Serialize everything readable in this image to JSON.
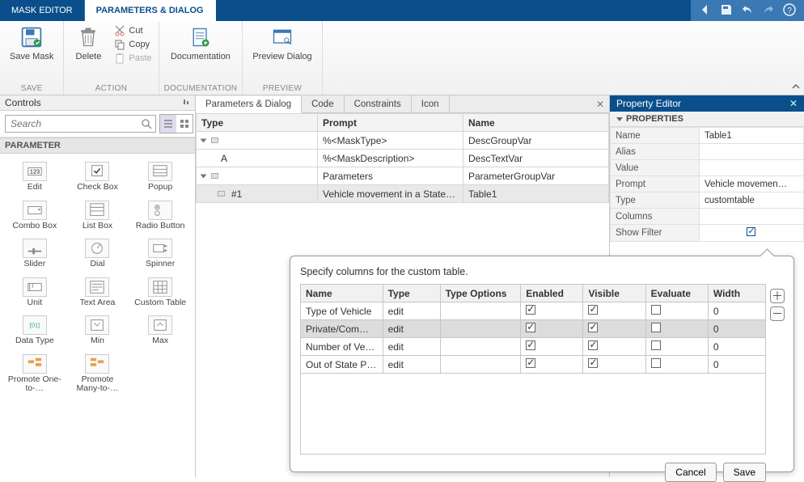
{
  "top_tabs": {
    "mask_editor": "MASK EDITOR",
    "parameters_dialog": "PARAMETERS & DIALOG"
  },
  "ribbon": {
    "save": {
      "save_mask": "Save Mask",
      "group": "SAVE"
    },
    "action": {
      "delete": "Delete",
      "cut": "Cut",
      "copy": "Copy",
      "paste": "Paste",
      "group": "ACTION"
    },
    "documentation": {
      "btn": "Documentation",
      "group": "DOCUMENTATION"
    },
    "preview": {
      "btn": "Preview Dialog",
      "group": "PREVIEW"
    }
  },
  "controls": {
    "title": "Controls",
    "search_placeholder": "Search",
    "section": "PARAMETER",
    "items": [
      "Edit",
      "Check Box",
      "Popup",
      "Combo Box",
      "List Box",
      "Radio Button",
      "Slider",
      "Dial",
      "Spinner",
      "Unit",
      "Text Area",
      "Custom Table",
      "Data Type",
      "Min",
      "Max",
      "Promote One-to-…",
      "Promote Many-to-…"
    ]
  },
  "center_tabs": {
    "params": "Parameters & Dialog",
    "code": "Code",
    "constraints": "Constraints",
    "icon": "Icon"
  },
  "params_header": {
    "type": "Type",
    "prompt": "Prompt",
    "name": "Name"
  },
  "params_rows": [
    {
      "indent": 0,
      "expander": true,
      "type_icon": "folder",
      "prompt": "%<MaskType>",
      "name": "DescGroupVar"
    },
    {
      "indent": 1,
      "expander": false,
      "type_text": "A",
      "prompt": "%<MaskDescription>",
      "name": "DescTextVar"
    },
    {
      "indent": 0,
      "expander": true,
      "type_icon": "folder",
      "prompt": "Parameters",
      "name": "ParameterGroupVar"
    },
    {
      "indent": 1,
      "expander": false,
      "type_text": "#1",
      "type_icon": "table",
      "prompt": "Vehicle movement in a State…",
      "name": "Table1",
      "selected": true
    }
  ],
  "prop": {
    "title": "Property Editor",
    "section": "PROPERTIES",
    "rows": {
      "Name": "Table1",
      "Alias": "",
      "Value": "",
      "Prompt": "Vehicle movemen…",
      "Type": "customtable",
      "Columns": "",
      "Show Filter": true
    },
    "keys": [
      "Name",
      "Alias",
      "Value",
      "Prompt",
      "Type",
      "Columns",
      "Show Filter"
    ]
  },
  "dialog": {
    "title": "Specify columns for the custom table.",
    "headers": [
      "Name",
      "Type",
      "Type Options",
      "Enabled",
      "Visible",
      "Evaluate",
      "Width"
    ],
    "rows": [
      {
        "name": "Type of Vehicle",
        "type": "edit",
        "enabled": true,
        "visible": true,
        "evaluate": false,
        "width": "0"
      },
      {
        "name": "Private/Com…",
        "type": "edit",
        "enabled": true,
        "visible": true,
        "evaluate": false,
        "width": "0",
        "selected": true
      },
      {
        "name": "Number of Ve…",
        "type": "edit",
        "enabled": true,
        "visible": true,
        "evaluate": false,
        "width": "0"
      },
      {
        "name": "Out of State P…",
        "type": "edit",
        "enabled": true,
        "visible": true,
        "evaluate": false,
        "width": "0"
      }
    ],
    "buttons": {
      "cancel": "Cancel",
      "save": "Save"
    }
  }
}
